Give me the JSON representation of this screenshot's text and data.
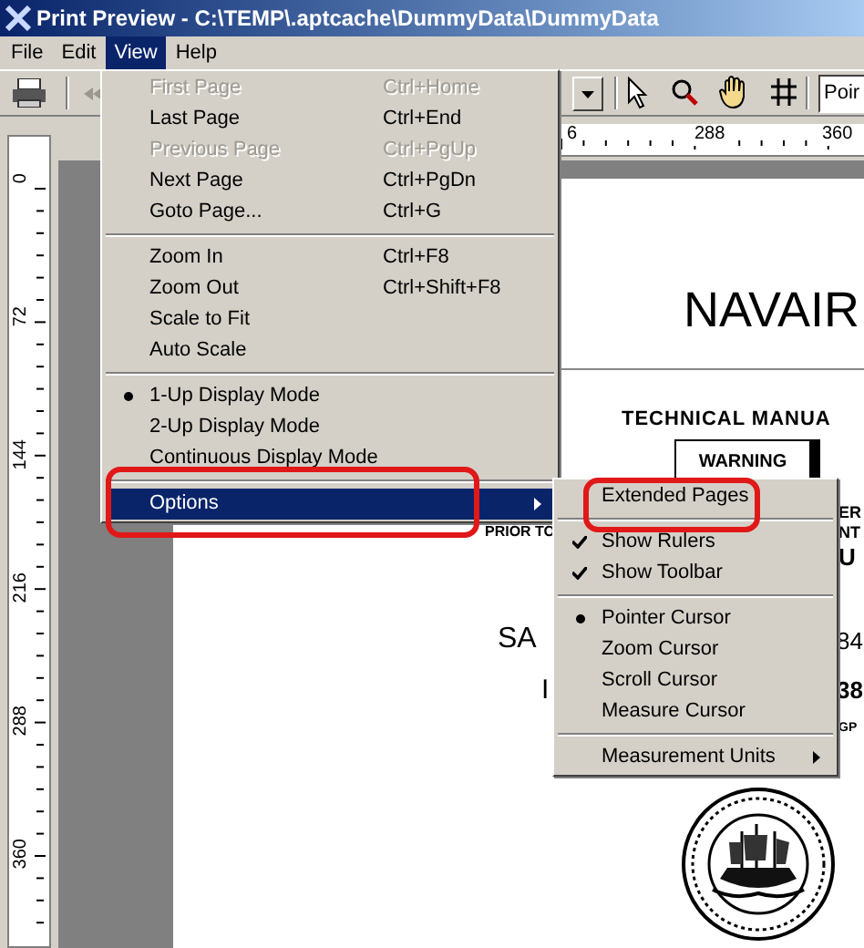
{
  "window": {
    "title": "Print Preview - C:\\TEMP\\.aptcache\\DummyData\\DummyData"
  },
  "menu_bar": [
    {
      "label": "File",
      "selected": false
    },
    {
      "label": "Edit",
      "selected": false
    },
    {
      "label": "View",
      "selected": true
    },
    {
      "label": "Help",
      "selected": false
    }
  ],
  "toolbar": {
    "zoom_field": "Poir"
  },
  "rulers": {
    "horizontal": [
      "6",
      "288",
      "360"
    ],
    "vertical": [
      "0",
      "72",
      "144",
      "216",
      "288",
      "360"
    ]
  },
  "document": {
    "title": "NAVAIR",
    "heading": "TECHNICAL MANUA",
    "warning": "WARNING",
    "notice": "PRIOR TO",
    "side_1": "ER",
    "side_2": "NT",
    "side_3": "U",
    "line_1": "SA",
    "line_1_end": "84",
    "line_2": "I",
    "line_2_end": "38",
    "line_3_end": "GP"
  },
  "view_menu": {
    "items": [
      {
        "kind": "item",
        "label": "First Page",
        "shortcut": "Ctrl+Home",
        "disabled": true
      },
      {
        "kind": "item",
        "label": "Last Page",
        "shortcut": "Ctrl+End",
        "disabled": false
      },
      {
        "kind": "item",
        "label": "Previous Page",
        "shortcut": "Ctrl+PgUp",
        "disabled": true
      },
      {
        "kind": "item",
        "label": "Next Page",
        "shortcut": "Ctrl+PgDn",
        "disabled": false
      },
      {
        "kind": "item",
        "label": "Goto Page...",
        "shortcut": "Ctrl+G",
        "disabled": false
      },
      {
        "kind": "separator"
      },
      {
        "kind": "item",
        "label": "Zoom In",
        "shortcut": "Ctrl+F8",
        "disabled": false
      },
      {
        "kind": "item",
        "label": "Zoom Out",
        "shortcut": "Ctrl+Shift+F8",
        "disabled": false
      },
      {
        "kind": "item",
        "label": "Scale to Fit",
        "disabled": false
      },
      {
        "kind": "item",
        "label": "Auto Scale",
        "disabled": false
      },
      {
        "kind": "separator"
      },
      {
        "kind": "radio",
        "label": "1-Up Display Mode",
        "checked": true
      },
      {
        "kind": "radio",
        "label": "2-Up Display Mode",
        "checked": false
      },
      {
        "kind": "radio",
        "label": "Continuous Display Mode",
        "checked": false
      },
      {
        "kind": "separator"
      },
      {
        "kind": "submenu",
        "label": "Options",
        "selected": true
      }
    ]
  },
  "options_menu": {
    "items": [
      {
        "kind": "item",
        "label": "Extended Pages",
        "disabled": false
      },
      {
        "kind": "separator"
      },
      {
        "kind": "check",
        "label": "Show Rulers",
        "checked": true
      },
      {
        "kind": "check",
        "label": "Show Toolbar",
        "checked": true
      },
      {
        "kind": "separator"
      },
      {
        "kind": "radio",
        "label": "Pointer Cursor",
        "checked": true
      },
      {
        "kind": "radio",
        "label": "Zoom Cursor",
        "checked": false
      },
      {
        "kind": "radio",
        "label": "Scroll Cursor",
        "checked": false
      },
      {
        "kind": "radio",
        "label": "Measure Cursor",
        "checked": false
      },
      {
        "kind": "separator"
      },
      {
        "kind": "submenu",
        "label": "Measurement Units",
        "selected": false
      }
    ]
  }
}
